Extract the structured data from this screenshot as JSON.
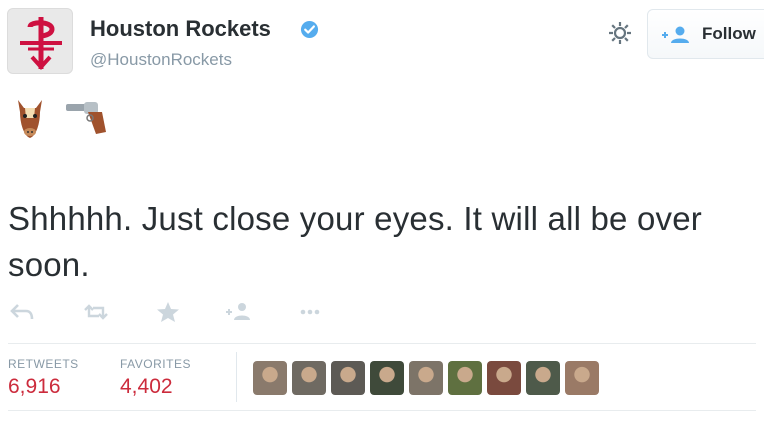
{
  "account": {
    "name": "Houston Rockets",
    "handle": "@HoustonRockets",
    "avatar_icon": "rockets-logo-icon",
    "verified_icon": "verified-badge-icon",
    "brand_color": "#ce1141"
  },
  "header": {
    "settings_icon": "gear-icon",
    "follow_label": "Follow",
    "follow_icon": "add-user-icon"
  },
  "emojis": [
    "horse-face-emoji",
    "pistol-emoji"
  ],
  "tweet": {
    "text": "Shhhhh. Just close your eyes. It will all be over soon."
  },
  "actions": [
    "reply-icon",
    "retweet-icon",
    "favorite-icon",
    "follow-icon",
    "more-icon"
  ],
  "stats": {
    "retweets_label": "RETWEETS",
    "retweets_value": "6,916",
    "favorites_label": "FAVORITES",
    "favorites_value": "4,402",
    "value_color": "#cc2b3c"
  },
  "favoriters": {
    "count_shown": 9,
    "colors": [
      "#8a7a6c",
      "#6f6a62",
      "#5d5a55",
      "#3f4a3a",
      "#7d7468",
      "#5f7040",
      "#7a4a3e",
      "#4e5a4a",
      "#9a7a66"
    ]
  }
}
